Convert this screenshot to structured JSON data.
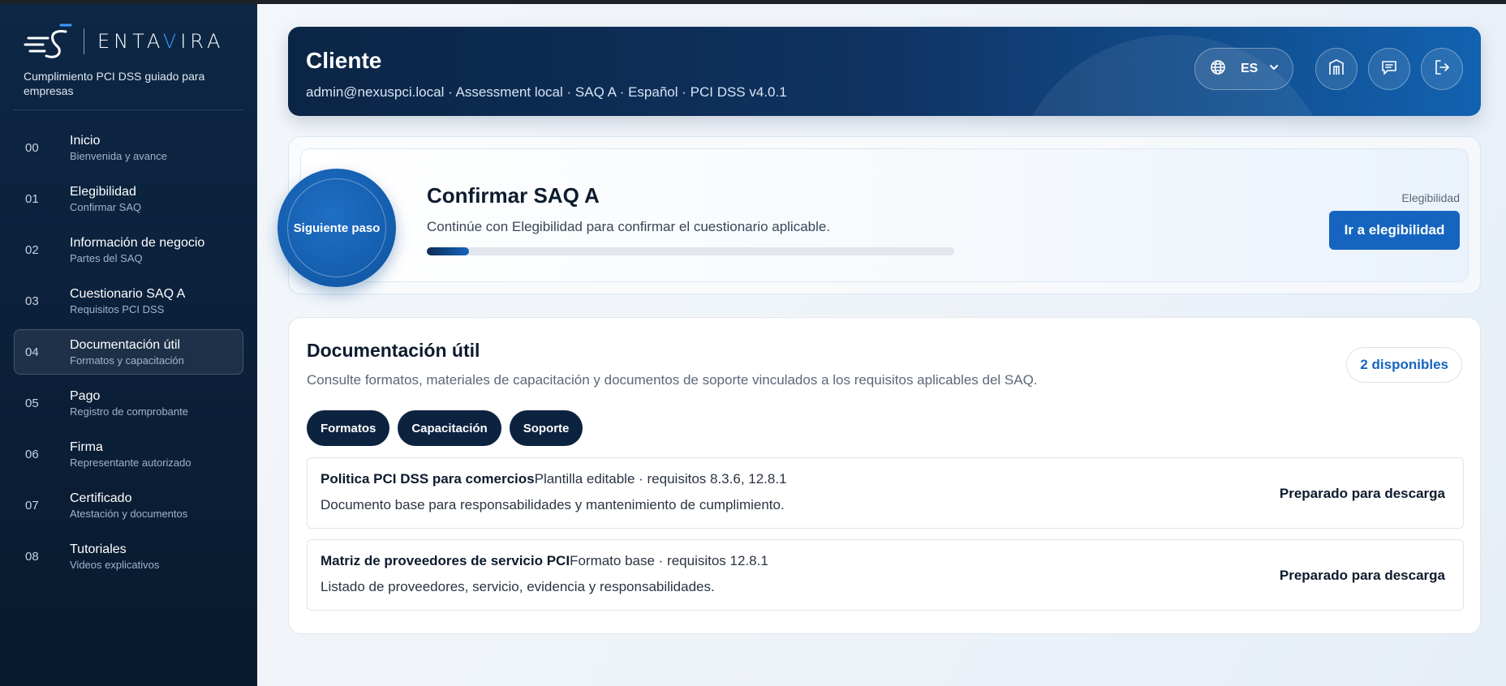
{
  "brand": {
    "name_prefix": "ENTA",
    "name_accent": "V",
    "name_suffix": "IRA",
    "tagline": "Cumplimiento PCI DSS guiado para empresas"
  },
  "sidebar": {
    "items": [
      {
        "num": "00",
        "label": "Inicio",
        "sub": "Bienvenida y avance",
        "active": false
      },
      {
        "num": "01",
        "label": "Elegibilidad",
        "sub": "Confirmar SAQ",
        "active": false
      },
      {
        "num": "02",
        "label": "Información de negocio",
        "sub": "Partes del SAQ",
        "active": false
      },
      {
        "num": "03",
        "label": "Cuestionario SAQ A",
        "sub": "Requisitos PCI DSS",
        "active": false
      },
      {
        "num": "04",
        "label": "Documentación útil",
        "sub": "Formatos y capacitación",
        "active": true
      },
      {
        "num": "05",
        "label": "Pago",
        "sub": "Registro de comprobante",
        "active": false
      },
      {
        "num": "06",
        "label": "Firma",
        "sub": "Representante autorizado",
        "active": false
      },
      {
        "num": "07",
        "label": "Certificado",
        "sub": "Atestación y documentos",
        "active": false
      },
      {
        "num": "08",
        "label": "Tutoriales",
        "sub": "Videos explicativos",
        "active": false
      }
    ]
  },
  "header": {
    "title": "Cliente",
    "subtitle": "admin@nexuspci.local · Assessment local · SAQ A · Español · PCI DSS v4.0.1",
    "language": "ES",
    "icons": [
      "globe-icon",
      "chevron-down-icon",
      "building-icon",
      "chat-icon",
      "logout-icon"
    ]
  },
  "next_step": {
    "badge": "Siguiente paso",
    "title": "Confirmar SAQ A",
    "description": "Continúe con Elegibilidad para confirmar el cuestionario aplicable.",
    "progress": 0.08,
    "kicker": "Elegibilidad",
    "cta": "Ir a elegibilidad"
  },
  "docs": {
    "title": "Documentación útil",
    "description": "Consulte formatos, materiales de capacitación y documentos de soporte vinculados a los requisitos aplicables del SAQ.",
    "count": "2 disponibles",
    "filters": [
      "Formatos",
      "Capacitación",
      "Soporte"
    ],
    "rows": [
      {
        "name": "Politica PCI DSS para comercios",
        "meta": "Plantilla editable · requisitos 8.3.6, 12.8.1",
        "description": "Documento base para responsabilidades y mantenimiento de cumplimiento.",
        "status": "Preparado para descarga"
      },
      {
        "name": "Matriz de proveedores de servicio PCI",
        "meta": "Formato base · requisitos 12.8.1",
        "description": "Listado de proveedores, servicio, evidencia y responsabilidades.",
        "status": "Preparado para descarga"
      }
    ]
  },
  "colors": {
    "sidebar_bg": "#0b1f38",
    "accent": "#1565c0",
    "chip_bg": "#0c2340",
    "header_gradient_end": "#1262b0"
  }
}
